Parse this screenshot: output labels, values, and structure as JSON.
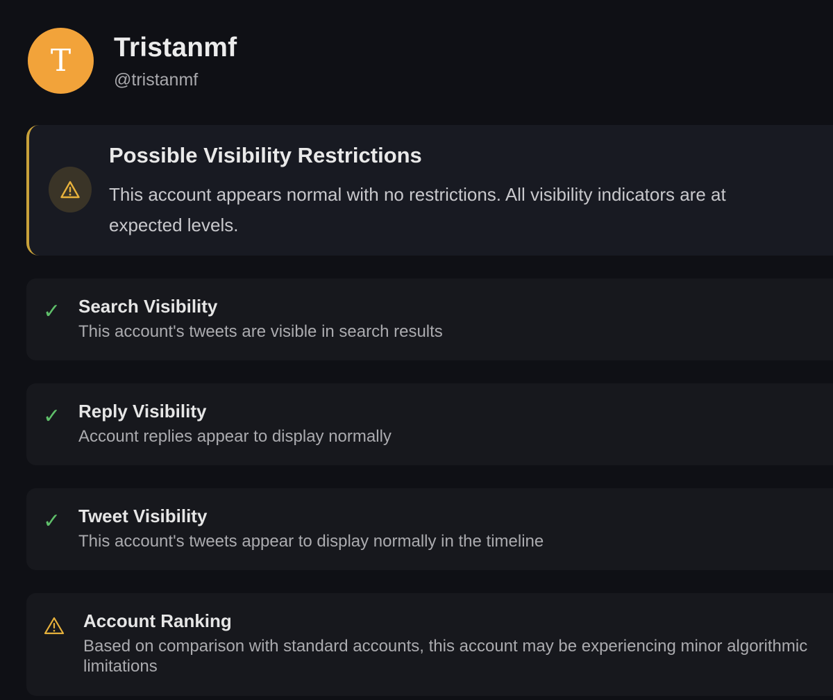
{
  "profile": {
    "avatar_initial": "T",
    "avatar_color": "#f2a33a",
    "display_name": "Tristanmf",
    "handle": "@tristanmf"
  },
  "alert": {
    "icon": "warning-icon",
    "accent_color": "#c9a23a",
    "title": "Possible Visibility Restrictions",
    "description": "This account appears normal with no restrictions. All visibility indicators are at expected levels."
  },
  "checks": [
    {
      "icon": "check-icon",
      "title": "Search Visibility",
      "description": "This account's tweets are visible in search results"
    },
    {
      "icon": "check-icon",
      "title": "Reply Visibility",
      "description": "Account replies appear to display normally"
    },
    {
      "icon": "check-icon",
      "title": "Tweet Visibility",
      "description": "This account's tweets appear to display normally in the timeline"
    },
    {
      "icon": "warning-icon",
      "title": "Account Ranking",
      "description": "Based on comparison with standard accounts, this account may be experiencing minor algorithmic limitations"
    }
  ],
  "colors": {
    "success": "#5fbf6a",
    "warning": "#e8b23c",
    "background": "#0f1015"
  }
}
